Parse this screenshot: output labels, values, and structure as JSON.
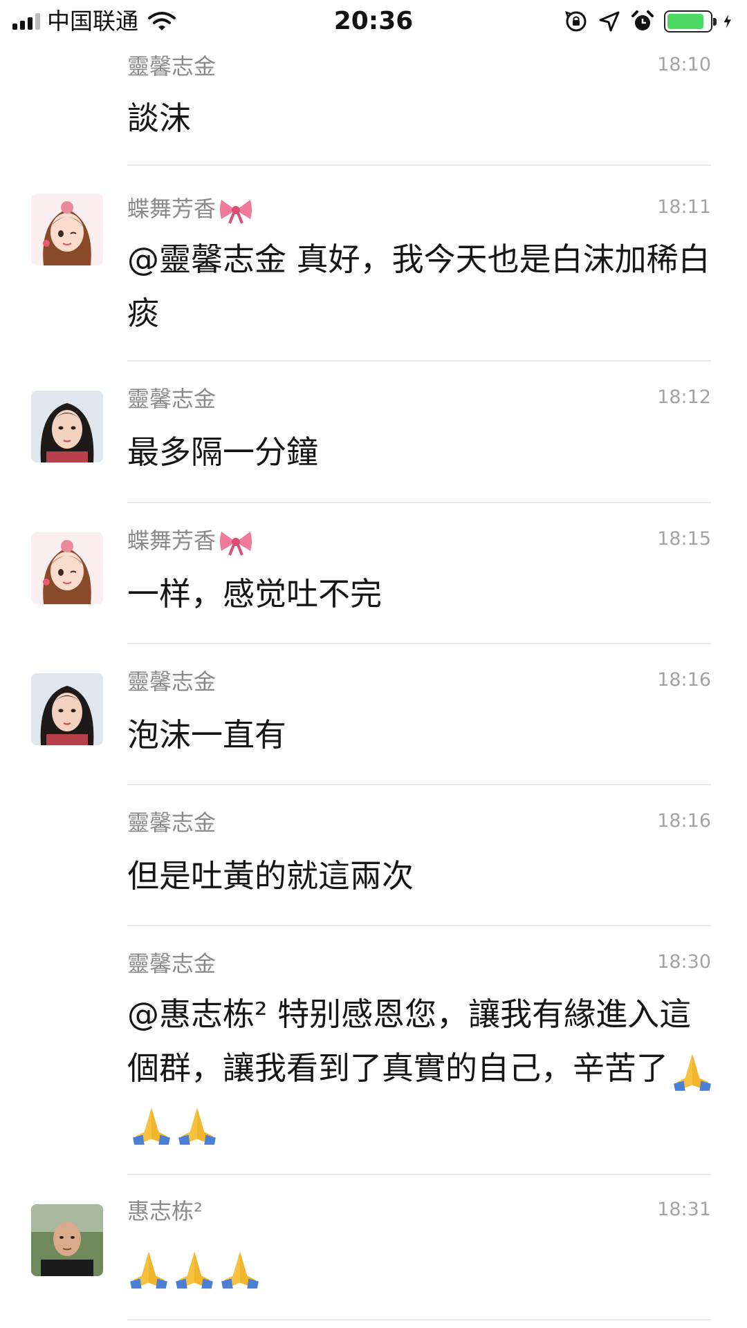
{
  "status_bar": {
    "carrier": "中国联通",
    "time": "20:36",
    "battery_color": "#4cd964"
  },
  "messages": [
    {
      "sender": "靈馨志金",
      "time": "18:10",
      "text": "談沫"
    },
    {
      "sender": "蝶舞芳香",
      "sender_emoji": "ribbon-bow",
      "time": "18:11",
      "text": "@靈馨志金 真好，我今天也是白沫加稀白痰"
    },
    {
      "sender": "靈馨志金",
      "time": "18:12",
      "text": "最多隔一分鐘"
    },
    {
      "sender": "蝶舞芳香",
      "sender_emoji": "ribbon-bow",
      "time": "18:15",
      "text": "一样，感觉吐不完"
    },
    {
      "sender": "靈馨志金",
      "time": "18:16",
      "text": "泡沫一直有"
    },
    {
      "sender": "靈馨志金",
      "time": "18:16",
      "text": "但是吐黃的就這兩次"
    },
    {
      "sender": "靈馨志金",
      "time": "18:30",
      "text": "@惠志栋² 特别感恩您，讓我有緣進入這個群，讓我看到了真實的自己，辛苦了",
      "emoji": "folded-hands x3"
    },
    {
      "sender": "惠志栋²",
      "time": "18:31",
      "text": "",
      "emoji": "folded-hands x3"
    }
  ]
}
